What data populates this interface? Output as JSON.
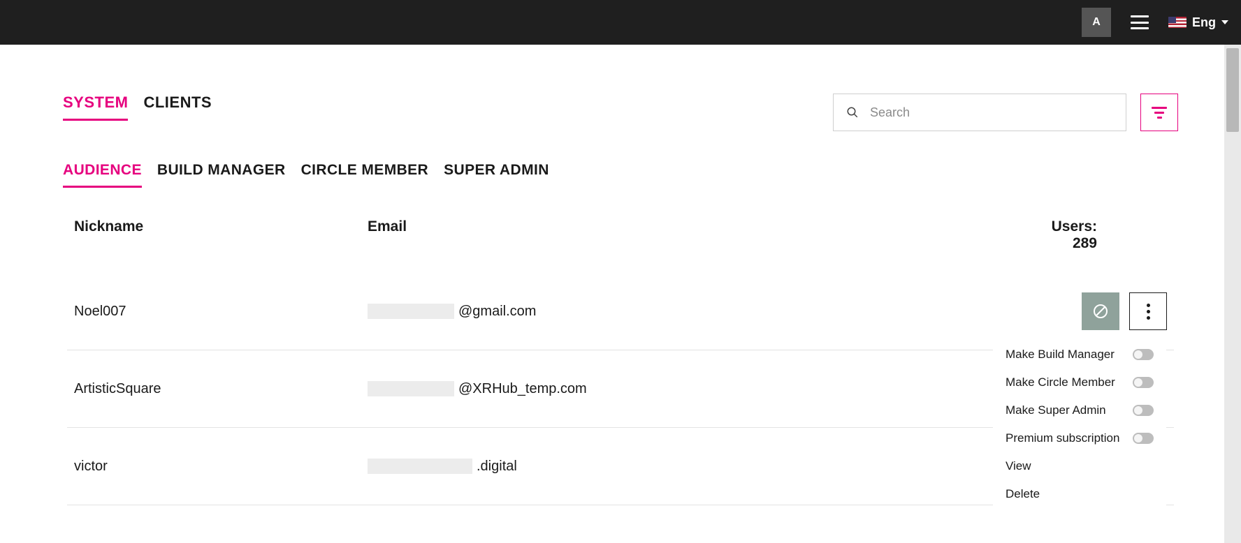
{
  "header": {
    "avatar_letter": "A",
    "language_label": "Eng"
  },
  "tabs_primary": {
    "system": "SYSTEM",
    "clients": "CLIENTS",
    "active": "system"
  },
  "search": {
    "placeholder": "Search"
  },
  "tabs_secondary": {
    "audience": "AUDIENCE",
    "build_manager": "BUILD MANAGER",
    "circle_member": "CIRCLE MEMBER",
    "super_admin": "SUPER ADMIN",
    "active": "audience"
  },
  "table": {
    "columns": {
      "nickname": "Nickname",
      "email": "Email",
      "users_label": "Users: 289"
    },
    "rows": [
      {
        "nickname": "Noel007",
        "email_suffix": "@gmail.com"
      },
      {
        "nickname": "ArtisticSquare",
        "email_suffix": "@XRHub_temp.com"
      },
      {
        "nickname": "victor",
        "email_suffix": ".digital"
      }
    ]
  },
  "row_menu": {
    "make_build_manager": "Make Build Manager",
    "make_circle_member": "Make Circle Member",
    "make_super_admin": "Make Super Admin",
    "premium_sub": "Premium subscription",
    "view": "View",
    "delete": "Delete"
  },
  "colors": {
    "accent": "#e6007e"
  }
}
